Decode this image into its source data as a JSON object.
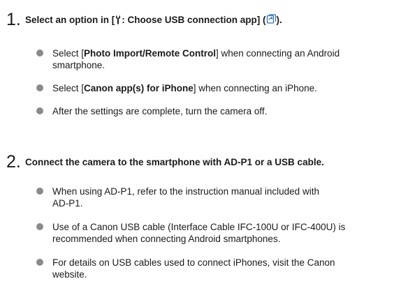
{
  "step1": {
    "number": "1.",
    "title_prefix": "Select an option in [",
    "title_icon": "wrench-icon",
    "title_menu": ": Choose USB connection app] (",
    "title_ref_icon": "page-reference-icon",
    "title_suffix": ").",
    "bullets": [
      {
        "pre": "Select [",
        "bold": "Photo Import/Remote Control",
        "post": "] when connecting an Android",
        "line2": "smartphone."
      },
      {
        "pre": "Select [",
        "bold": "Canon app(s) for iPhone",
        "post": "] when connecting an iPhone.",
        "line2": ""
      },
      {
        "text": "After the settings are complete, turn the camera off."
      }
    ]
  },
  "step2": {
    "number": "2.",
    "title": "Connect the camera to the smartphone with AD-P1 or a USB cable.",
    "bullets": [
      {
        "line1": "When using AD-P1, refer to the instruction manual included with",
        "line2": "AD-P1."
      },
      {
        "line1": "Use of a Canon USB cable (Interface Cable IFC-100U or IFC-400U) is",
        "line2": "recommended when connecting Android smartphones."
      },
      {
        "line1": "For details on USB cables used to connect iPhones, visit the Canon",
        "line2": "website."
      }
    ]
  },
  "colors": {
    "text": "#1a1a1a",
    "bullet": "#8a8a8a",
    "ref_icon": "#2a6fb3"
  }
}
